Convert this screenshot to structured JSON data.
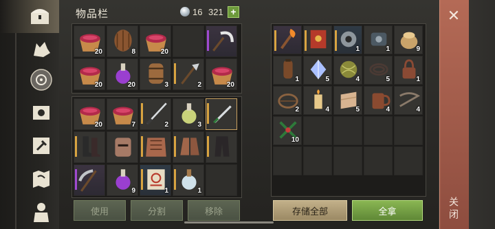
{
  "header": {
    "title": "物品栏",
    "currency": "16",
    "capacity": "321",
    "plus_label": "+"
  },
  "tabs": [
    {
      "name": "chest-tab",
      "icon": "chest-icon"
    },
    {
      "name": "wolf-tab",
      "icon": "wolf-icon"
    },
    {
      "name": "settlement-tab",
      "icon": "compass-icon"
    },
    {
      "name": "sun-tab",
      "icon": "sun-scroll-icon"
    },
    {
      "name": "crafting-tab",
      "icon": "hammer-icon"
    },
    {
      "name": "map-tab",
      "icon": "map-icon"
    },
    {
      "name": "character-tab",
      "icon": "character-icon"
    }
  ],
  "inventory_top": [
    {
      "item": "bowl-berries",
      "count": "20"
    },
    {
      "item": "barrel",
      "count": "8"
    },
    {
      "item": "bowl-berries",
      "count": "20"
    },
    {
      "item": "",
      "count": ""
    },
    {
      "item": "sickle",
      "count": ""
    },
    {
      "item": "bowl-berries",
      "count": "20"
    },
    {
      "item": "purple-potion",
      "count": "20"
    },
    {
      "item": "wooden-barrel",
      "count": "3"
    },
    {
      "item": "halberd",
      "count": "2"
    },
    {
      "item": "bowl-berries",
      "count": "20"
    }
  ],
  "inventory_bottom": [
    {
      "item": "bowl-berries",
      "count": "20"
    },
    {
      "item": "bowl-berries",
      "count": "7"
    },
    {
      "item": "katana",
      "count": "2"
    },
    {
      "item": "green-potion",
      "count": "3"
    },
    {
      "item": "short-sword",
      "count": ""
    },
    {
      "item": "boots",
      "count": ""
    },
    {
      "item": "helmet",
      "count": ""
    },
    {
      "item": "chest-armor",
      "count": ""
    },
    {
      "item": "gloves",
      "count": ""
    },
    {
      "item": "pants",
      "count": ""
    },
    {
      "item": "scythe",
      "count": ""
    },
    {
      "item": "purple-potion",
      "count": "9"
    },
    {
      "item": "recipe-scroll",
      "count": "1"
    },
    {
      "item": "white-potion",
      "count": "1"
    },
    {
      "item": "",
      "count": ""
    }
  ],
  "storage": [
    {
      "item": "torch",
      "count": ""
    },
    {
      "item": "red-book",
      "count": ""
    },
    {
      "item": "pipe-fitting",
      "count": "1"
    },
    {
      "item": "engine-part",
      "count": "1"
    },
    {
      "item": "grain-sack",
      "count": "9"
    },
    {
      "item": "leather-flask",
      "count": "1"
    },
    {
      "item": "crystal",
      "count": "5"
    },
    {
      "item": "yarn-ball",
      "count": "4"
    },
    {
      "item": "rope",
      "count": "5"
    },
    {
      "item": "padlock",
      "count": "1"
    },
    {
      "item": "bear-trap",
      "count": "2"
    },
    {
      "item": "candle",
      "count": "4"
    },
    {
      "item": "cloth",
      "count": "5"
    },
    {
      "item": "mug",
      "count": "4"
    },
    {
      "item": "chain",
      "count": "4"
    },
    {
      "item": "herb-bundle",
      "count": "10"
    }
  ],
  "buttons": {
    "use": "使用",
    "split": "分割",
    "remove": "移除",
    "store_all": "存储全部",
    "take_all": "全拿"
  },
  "close": {
    "x": "✕",
    "label": "关闭"
  },
  "colors": {
    "accent_green": "#8ab653",
    "close_red": "#b46a56",
    "gold_bar": "#d9a441",
    "purple_bar": "#a04ad0"
  }
}
